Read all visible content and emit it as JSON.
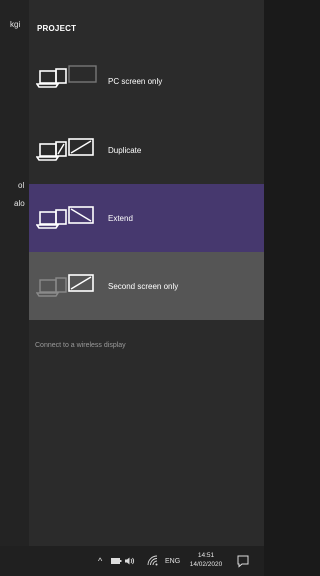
{
  "background": {
    "edge_fragments": [
      {
        "text": "kgi"
      },
      {
        "text": "ol"
      },
      {
        "text": "alo"
      }
    ]
  },
  "panel": {
    "title": "PROJECT",
    "options": [
      {
        "label": "PC screen only",
        "icon": "pc-screen-only-icon",
        "state": "normal"
      },
      {
        "label": "Duplicate",
        "icon": "duplicate-icon",
        "state": "normal"
      },
      {
        "label": "Extend",
        "icon": "extend-icon",
        "state": "selected"
      },
      {
        "label": "Second screen only",
        "icon": "second-screen-only-icon",
        "state": "hover"
      }
    ],
    "wireless_link": "Connect to a wireless display"
  },
  "taskbar": {
    "chevron": "^",
    "language": "ENG",
    "time": "14:51",
    "date": "14/02/2020"
  },
  "colors": {
    "selected": "#46386e",
    "hover": "#555555",
    "panel": "#2b2b2b",
    "text": "#ffffff",
    "muted": "#9a9a9a"
  }
}
